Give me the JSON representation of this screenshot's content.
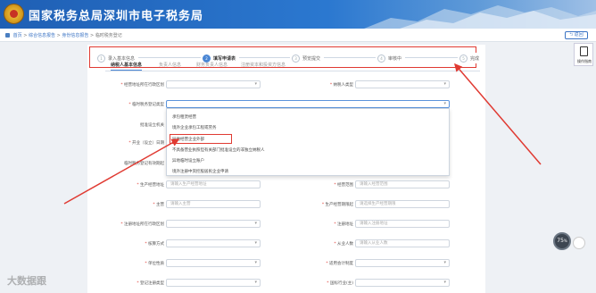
{
  "header": {
    "title": "国家税务总局深圳市电子税务局"
  },
  "breadcrumb": {
    "items": [
      "首页",
      "综合信息报告",
      "身份信息报告",
      "临时税务登记"
    ]
  },
  "back_button": "返回",
  "side_panel": {
    "label": "操作指南"
  },
  "steps": [
    {
      "num": "1",
      "label": "录入基本信息",
      "active": false
    },
    {
      "num": "2",
      "label": "填写申请表",
      "active": true
    },
    {
      "num": "3",
      "label": "预览提交",
      "active": false
    },
    {
      "num": "4",
      "label": "审核中",
      "active": false
    },
    {
      "num": "5",
      "label": "完成",
      "active": false
    }
  ],
  "tabs": [
    "纳税人基本信息",
    "负责人信息",
    "财务负责人信息",
    "注册资本和投资方信息"
  ],
  "form": {
    "reg_region_label": "经营地址所在行政区划",
    "taxpayer_type_label": "纳税人类型",
    "temp_reg_type_label": "临时税务登记类型",
    "approval_org_label": "批准设立机关",
    "approval_num_label": "证照号码",
    "opening_date_label": "开业（设立）日期",
    "license_num_label": "临时税务登记有效期起",
    "prod_address_label": "生产经营地址",
    "prod_address_placeholder": "请输入生产经营地址",
    "scope_label": "经营范围",
    "scope_placeholder": "请输入经营范围",
    "main_label": "主营",
    "main_placeholder": "请输入主营",
    "prod_period_label": "生产经营期限起",
    "prod_period_placeholder": "请选择生产经营期限",
    "reg_region2_label": "注册地址所在行政区划",
    "reg_address_label": "注册地址",
    "reg_address_placeholder": "请输入注册地址",
    "accounting_label": "核算方式",
    "employees_label": "从业人数",
    "employees_placeholder": "请输入从业人数",
    "unit_nature_label": "单位性质",
    "accounting_system_label": "适用会计制度",
    "reg_type_label": "登记注册类型",
    "industry_label": "国标行业(主)"
  },
  "dropdown_options": [
    "承包租赁经营",
    "境外企业承包工程或劳务",
    "异地经营企业外部",
    "不具备营业执照但有关部门批准设立的非独立纳税人",
    "异地临时设立账户",
    "境外注册中资控股居民企业申请"
  ],
  "speed_badge": {
    "value": "75",
    "unit": "%"
  },
  "watermark": "大数据跟"
}
